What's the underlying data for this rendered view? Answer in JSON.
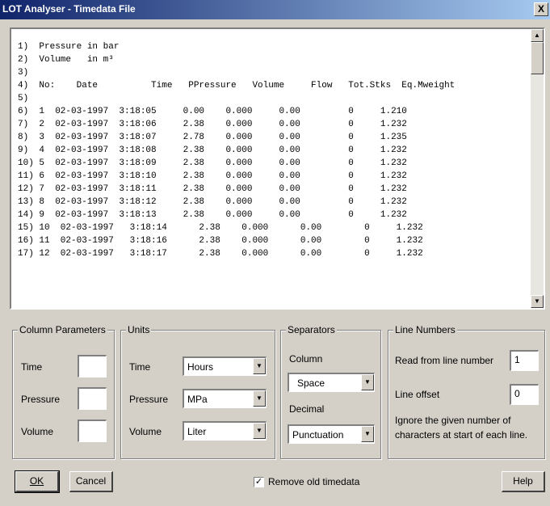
{
  "window": {
    "title": "LOT Analyser - Timedata File",
    "close_glyph": "X"
  },
  "file_lines": [
    "1)  Pressure in bar",
    "2)  Volume   in m³",
    "3)",
    "4)  No:    Date          Time   PPressure   Volume     Flow   Tot.Stks  Eq.Mweight",
    "5)",
    "6)  1  02-03-1997  3:18:05     0.00    0.000     0.00         0     1.210",
    "7)  2  02-03-1997  3:18:06     2.38    0.000     0.00         0     1.232",
    "8)  3  02-03-1997  3:18:07     2.78    0.000     0.00         0     1.235",
    "9)  4  02-03-1997  3:18:08     2.38    0.000     0.00         0     1.232",
    "10) 5  02-03-1997  3:18:09     2.38    0.000     0.00         0     1.232",
    "11) 6  02-03-1997  3:18:10     2.38    0.000     0.00         0     1.232",
    "12) 7  02-03-1997  3:18:11     2.38    0.000     0.00         0     1.232",
    "13) 8  02-03-1997  3:18:12     2.38    0.000     0.00         0     1.232",
    "14) 9  02-03-1997  3:18:13     2.38    0.000     0.00         0     1.232",
    "15) 10  02-03-1997   3:18:14      2.38    0.000      0.00        0     1.232",
    "16) 11  02-03-1997   3:18:16      2.38    0.000      0.00        0     1.232",
    "17) 12  02-03-1997   3:18:17      2.38    0.000      0.00        0     1.232"
  ],
  "column_parameters": {
    "title": "Column Parameters",
    "time_label": "Time",
    "time_value": "",
    "pressure_label": "Pressure",
    "pressure_value": "",
    "volume_label": "Volume",
    "volume_value": ""
  },
  "units": {
    "title": "Units",
    "time_label": "Time",
    "time_value": "Hours",
    "pressure_label": "Pressure",
    "pressure_value": "MPa",
    "volume_label": "Volume",
    "volume_value": "Liter"
  },
  "separators": {
    "title": "Separators",
    "column_label": "Column",
    "column_value": "Space",
    "decimal_label": "Decimal",
    "decimal_value": "Punctuation"
  },
  "line_numbers": {
    "title": "Line Numbers",
    "read_from_label": "Read from line number",
    "read_from_value": "1",
    "offset_label": "Line offset",
    "offset_value": "0",
    "help_text_1": "Ignore the given number of",
    "help_text_2": "characters at start of each line."
  },
  "buttons": {
    "ok": "OK",
    "cancel": "Cancel",
    "help": "Help"
  },
  "remove_old": {
    "label": "Remove old timedata",
    "checked": true
  }
}
